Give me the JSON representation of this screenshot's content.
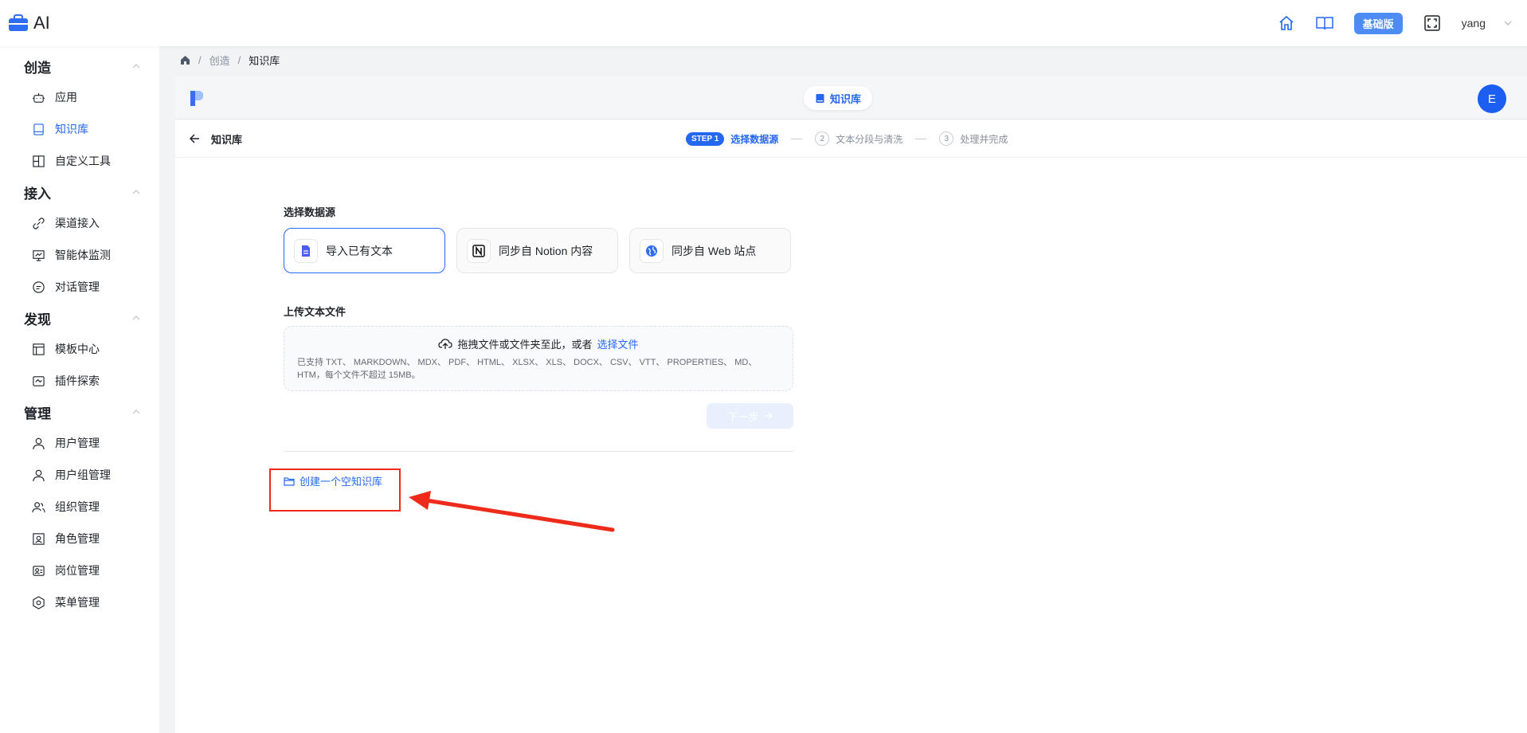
{
  "app": {
    "title": "AI"
  },
  "topbar": {
    "edition": "基础版",
    "user": "yang",
    "icons": [
      "home-icon",
      "docs-icon",
      "fullscreen-icon",
      "chevron-down-icon"
    ]
  },
  "sidebar": {
    "groups": [
      {
        "title": "创造",
        "items": [
          {
            "label": "应用",
            "icon": "robot-icon"
          },
          {
            "label": "知识库",
            "icon": "book-icon",
            "active": true
          },
          {
            "label": "自定义工具",
            "icon": "tool-icon"
          }
        ]
      },
      {
        "title": "接入",
        "items": [
          {
            "label": "渠道接入",
            "icon": "link-icon"
          },
          {
            "label": "智能体监测",
            "icon": "monitor-icon"
          },
          {
            "label": "对话管理",
            "icon": "chat-icon"
          }
        ]
      },
      {
        "title": "发现",
        "items": [
          {
            "label": "模板中心",
            "icon": "template-icon"
          },
          {
            "label": "插件探索",
            "icon": "plugin-icon"
          }
        ]
      },
      {
        "title": "管理",
        "items": [
          {
            "label": "用户管理",
            "icon": "user-icon"
          },
          {
            "label": "用户组管理",
            "icon": "user-group-icon"
          },
          {
            "label": "组织管理",
            "icon": "org-icon"
          },
          {
            "label": "角色管理",
            "icon": "role-icon"
          },
          {
            "label": "岗位管理",
            "icon": "position-icon"
          },
          {
            "label": "菜单管理",
            "icon": "menu-icon"
          }
        ]
      }
    ]
  },
  "breadcrumb": {
    "sep": "/",
    "items": [
      "创造",
      "知识库"
    ]
  },
  "panel": {
    "pill_label": "知识库",
    "avatar": "E",
    "back_label": "知识库",
    "steps": {
      "badge": "STEP 1",
      "active": "选择数据源",
      "step2_num": "2",
      "step2": "文本分段与清洗",
      "step3_num": "3",
      "step3": "处理并完成"
    }
  },
  "content": {
    "source_title": "选择数据源",
    "sources": [
      {
        "label": "导入已有文本",
        "selected": true
      },
      {
        "label": "同步自 Notion 内容"
      },
      {
        "label": "同步自 Web 站点"
      }
    ],
    "upload_title": "上传文本文件",
    "drop_text": "拖拽文件或文件夹至此，或者",
    "drop_link": "选择文件",
    "supported_formats": "已支持 TXT、 MARKDOWN、 MDX、 PDF、 HTML、 XLSX、 XLS、 DOCX、 CSV、 VTT、 PROPERTIES、 MD、 HTM，每个文件不超过 15MB。",
    "next_label": "下一步",
    "create_empty": "创建一个空知识库"
  },
  "colors": {
    "accent": "#2468f2",
    "annotation": "#ee2a1b"
  }
}
